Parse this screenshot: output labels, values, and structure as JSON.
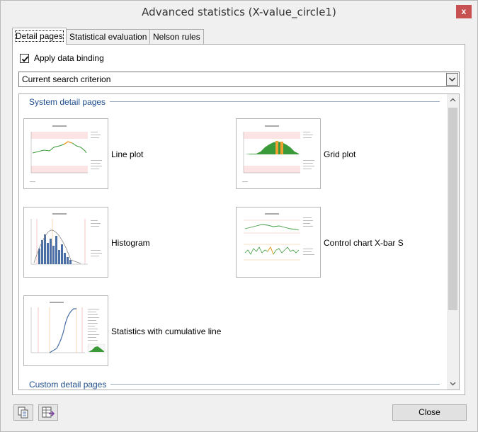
{
  "window": {
    "title": "Advanced statistics (X-value_circle1)",
    "close_glyph": "x"
  },
  "tabs": [
    {
      "label": "Detail pages",
      "active": true
    },
    {
      "label": "Statistical evaluation",
      "active": false
    },
    {
      "label": "Nelson rules",
      "active": false
    }
  ],
  "data_binding": {
    "label": "Apply data binding",
    "checked": true
  },
  "search_combo": {
    "value": "Current search criterion"
  },
  "sections": {
    "system": "System detail pages",
    "custom": "Custom detail pages"
  },
  "detail_pages": [
    {
      "label": "Line plot",
      "icon": "line-plot-thumbnail"
    },
    {
      "label": "Grid plot",
      "icon": "grid-plot-thumbnail"
    },
    {
      "label": "Histogram",
      "icon": "histogram-thumbnail"
    },
    {
      "label": "Control chart X-bar S",
      "icon": "control-chart-thumbnail"
    },
    {
      "label": "Statistics with cumulative line",
      "icon": "cumulative-line-thumbnail"
    }
  ],
  "footer": {
    "close_label": "Close",
    "copy_icon": "copy-pages-icon",
    "export_icon": "export-table-icon"
  },
  "colors": {
    "section_text": "#1f4e8c",
    "close_bg": "#c75050",
    "chart_green": "#3a9a3a",
    "chart_orange": "#f0a030",
    "histogram_blue": "#4a6fa5"
  }
}
